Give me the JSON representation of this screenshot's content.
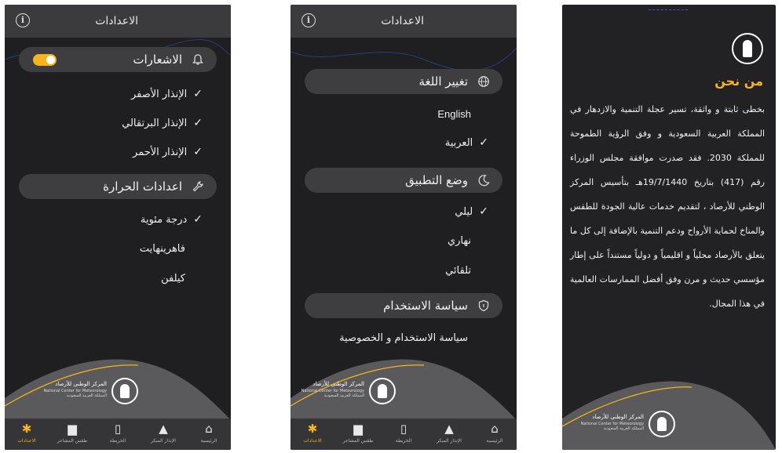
{
  "header": {
    "title": "الاعدادات",
    "info_icon": "info-icon"
  },
  "screen1": {
    "notifications": {
      "label": "الاشعارات",
      "icon": "bell-icon",
      "enabled": true
    },
    "alerts": [
      {
        "label": "الإنذار الأصفر",
        "checked": true
      },
      {
        "label": "الإنذار البرتقالي",
        "checked": true
      },
      {
        "label": "الإنذار الأحمر",
        "checked": true
      }
    ],
    "temperature": {
      "label": "اعدادات الحرارة",
      "icon": "wrench-icon"
    },
    "units": [
      {
        "label": "درجة مئوية",
        "checked": true
      },
      {
        "label": "فاهرينهايت",
        "checked": false
      },
      {
        "label": "كيلفن",
        "checked": false
      }
    ]
  },
  "screen2": {
    "language": {
      "label": "تغيير اللغة",
      "icon": "globe-icon"
    },
    "languages": [
      {
        "label": "English",
        "checked": false
      },
      {
        "label": "العربية",
        "checked": true
      }
    ],
    "mode": {
      "label": "وضع التطبيق",
      "icon": "moon-icon"
    },
    "modes": [
      {
        "label": "ليلي",
        "checked": true
      },
      {
        "label": "نهاري",
        "checked": false
      },
      {
        "label": "تلقائي",
        "checked": false
      }
    ],
    "policy": {
      "label": "سياسة الاستخدام",
      "icon": "shield-icon"
    },
    "policy_link": "سياسة الاستخدام و الخصوصية"
  },
  "logo": {
    "name_ar": "المركز الوطني للأرصاد",
    "name_en": "National Center for Meteorology",
    "country_ar": "المملكة العربية السعودية"
  },
  "tabbar": [
    {
      "label": "الرئيسية",
      "icon": "home-icon",
      "glyph": "⌂"
    },
    {
      "label": "الإنذار المبكر",
      "icon": "warning-icon",
      "glyph": "▲"
    },
    {
      "label": "الخريطة",
      "icon": "map-icon",
      "glyph": "▯"
    },
    {
      "label": "طقس المشاعر",
      "icon": "kaaba-icon",
      "glyph": "▆"
    },
    {
      "label": "الاعدادات",
      "icon": "gear-icon",
      "glyph": "✱",
      "active": true
    }
  ],
  "about": {
    "title": "من نحن",
    "body": "بخطى ثابتة و واثقة، تسير عجلة التنمية والازدهار في المملكة العربية السعودية و وفق الرؤية الطموحة للمملكة 2030. فقد صدرت موافقة مجلس الوزراء رقم (417) بتاريخ 19/7/1440هـ بتأسيس المركز الوطني للأرصاد ، لتقديم خدمات عالية الجودة للطقس والمناخ لحماية الأرواح ودعم التنمية بالإضافة إلى كل ما يتعلق بالأرصاد محلياً و اقليمياً و دولياً مستنداً على إطار مؤسسي حديث و مرن وفق أفضل الممارسات العالمية في هذا المجال."
  },
  "colors": {
    "accent": "#f7b51b",
    "background": "#1f1f21",
    "pill": "#3e3e40",
    "tabbar": "#353537"
  }
}
